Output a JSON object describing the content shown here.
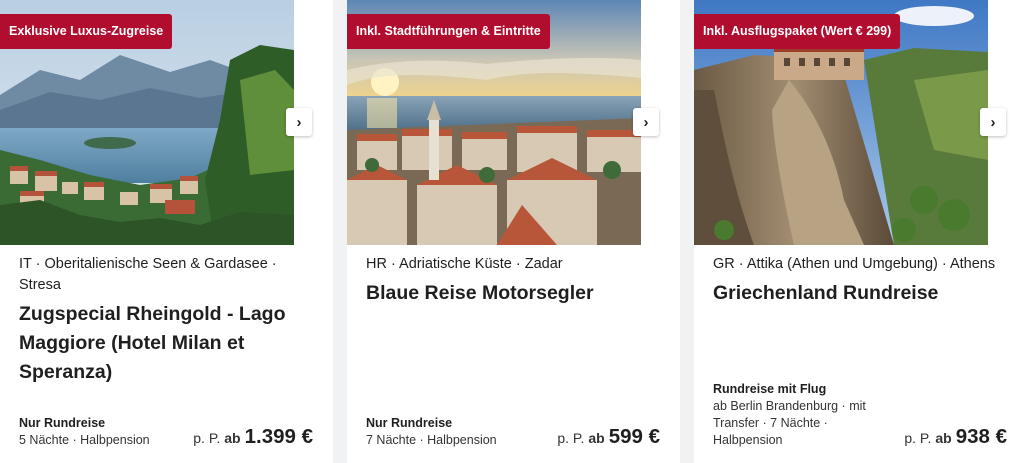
{
  "cards": [
    {
      "badge": "Exklusive Luxus-Zugreise",
      "region": "IT · Oberitalienische Seen & Gardasee · Stresa",
      "title": "Zugspecial Rheingold - Lago Maggiore (Hotel Milan et Speranza)",
      "type": "Nur Rundreise",
      "details": [
        "5 Nächte · Halbpension"
      ],
      "price_prefix": "p. P.",
      "price_ab": "ab",
      "price": "1.399 €"
    },
    {
      "badge": "Inkl. Stadtführungen & Eintritte",
      "region": "HR · Adriatische Küste · Zadar",
      "title": "Blaue Reise Motorsegler",
      "type": "Nur Rundreise",
      "details": [
        "7 Nächte · Halbpension"
      ],
      "price_prefix": "p. P.",
      "price_ab": "ab",
      "price": "599 €"
    },
    {
      "badge": "Inkl. Ausflugspaket (Wert € 299)",
      "region": "GR · Attika (Athen und Umgebung) · Athens",
      "title": "Griechenland Rundreise",
      "type": "Rundreise mit Flug",
      "details": [
        "ab Berlin Brandenburg · mit",
        "Transfer · 7 Nächte ·",
        "Halbpension"
      ],
      "price_prefix": "p. P.",
      "price_ab": "ab",
      "price": "938 €"
    }
  ],
  "icons": {
    "next": "chevron-right-icon"
  },
  "colors": {
    "badge": "#b10d2f",
    "background": "#f1f2f4",
    "card": "#ffffff"
  }
}
